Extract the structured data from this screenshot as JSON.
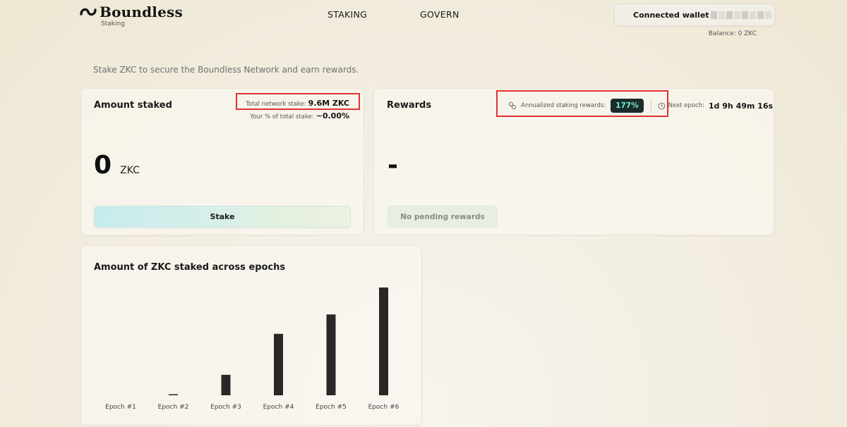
{
  "header": {
    "logo_text": "Boundless",
    "logo_sub": "Staking",
    "nav": [
      {
        "label": "STAKING"
      },
      {
        "label": "GOVERN"
      }
    ],
    "wallet_label": "Connected wallet",
    "balance": "Balance: 0 ZKC"
  },
  "tagline": "Stake ZKC to secure the Boundless Network and earn rewards.",
  "staked_card": {
    "title": "Amount staked",
    "total_label": "Total network stake:",
    "total_value": "9.6M ZKC",
    "pct_label": "Your % of total stake:",
    "pct_value": "~0.00%",
    "amount": "0",
    "unit": "ZKC",
    "stake_button": "Stake"
  },
  "rewards_card": {
    "title": "Rewards",
    "apr_label": "Annualized staking rewards:",
    "apr_value": "177%",
    "epoch_label": "Next epoch:",
    "epoch_value": "1d 9h 49m 16s",
    "value": "-",
    "pending_button": "No pending rewards"
  },
  "chart_card": {
    "title": "Amount of ZKC staked across epochs"
  },
  "chart_data": {
    "type": "bar",
    "title": "Amount of ZKC staked across epochs",
    "categories": [
      "Epoch #1",
      "Epoch #2",
      "Epoch #3",
      "Epoch #4",
      "Epoch #5",
      "Epoch #6"
    ],
    "values": [
      0,
      0.1,
      1.9,
      5.7,
      7.5,
      10.0
    ],
    "xlabel": "",
    "ylabel": "",
    "ylim": [
      0,
      10
    ],
    "grid": false,
    "bar_color": "#2a2826"
  },
  "colors": {
    "accent_badge_bg": "#1c2b2a",
    "accent_badge_text": "#6ff0d0",
    "highlight_box": "#e03232"
  },
  "icons": {
    "logo": "boundless-logo-icon",
    "apr": "link-icon",
    "epoch": "clock-icon"
  }
}
